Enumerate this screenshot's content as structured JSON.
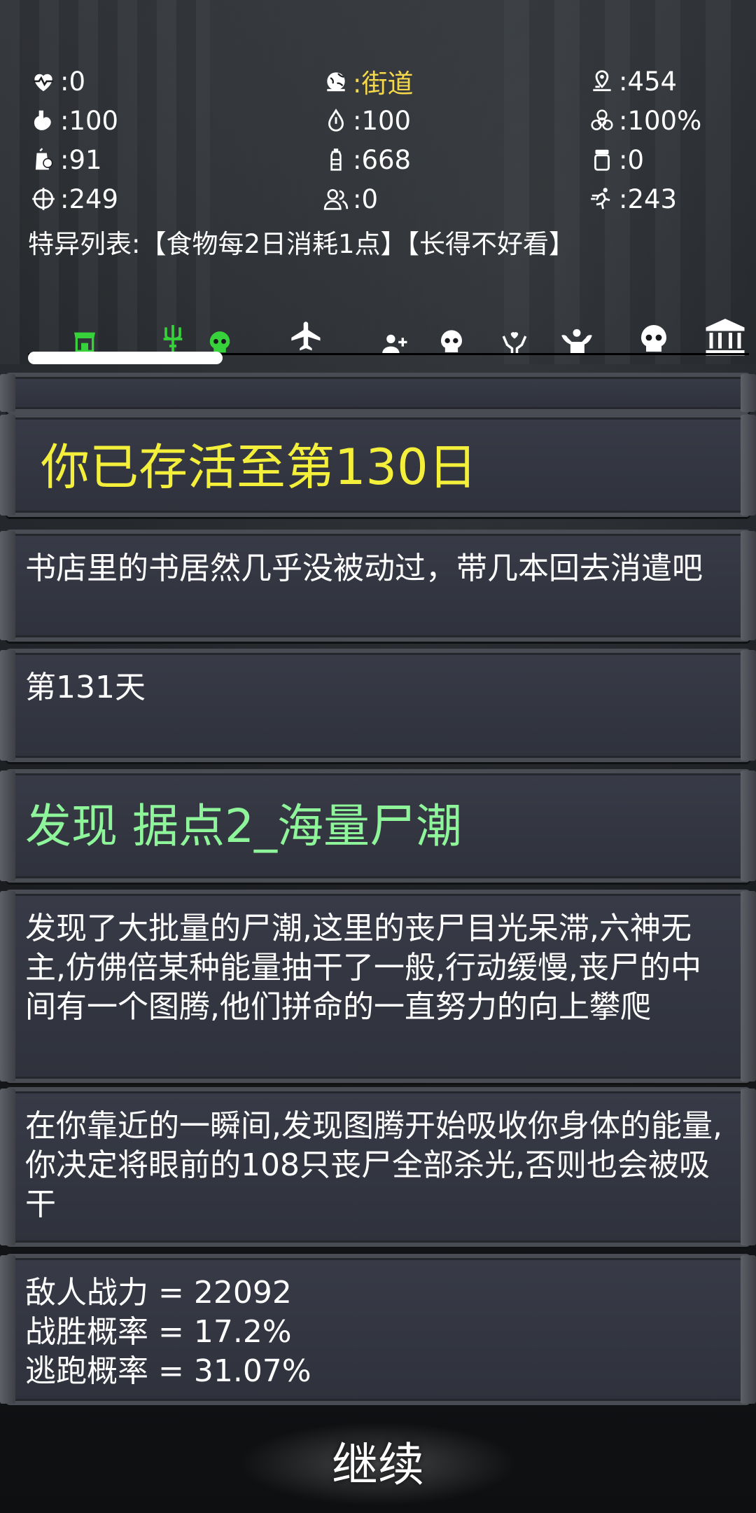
{
  "colors": {
    "location": "#f6d94a",
    "day_heading": "#f4ef3a",
    "event_heading": "#8ff59a",
    "tab_active": "#37d23b"
  },
  "stats": {
    "health": {
      "icon": "heartbeat-icon",
      "value": ":0"
    },
    "location": {
      "icon": "globe-pin-icon",
      "value": ":街道"
    },
    "distance": {
      "icon": "map-pin-icon",
      "value": ":454"
    },
    "hunger": {
      "icon": "stomach-icon",
      "value": ":100"
    },
    "thirst": {
      "icon": "water-drop-icon",
      "value": ":100"
    },
    "infection": {
      "icon": "biohazard-icon",
      "value": ":100%"
    },
    "food": {
      "icon": "food-bag-icon",
      "value": ":91"
    },
    "water": {
      "icon": "water-bottle-icon",
      "value": ":668"
    },
    "medicine": {
      "icon": "pill-jar-icon",
      "value": ":0"
    },
    "attack": {
      "icon": "crosshair-icon",
      "value": ":249"
    },
    "survivors": {
      "icon": "people-icon",
      "value": ":0"
    },
    "agility": {
      "icon": "runner-icon",
      "value": ":243"
    }
  },
  "traits": "特异列表:【食物每2日消耗1点】【长得不好看】",
  "tabs": [
    {
      "name": "tab-shop",
      "icon": "shop-icon",
      "active": true
    },
    {
      "name": "tab-trident",
      "icon": "trident-icon",
      "active": true
    },
    {
      "name": "tab-skull-green",
      "icon": "skull-icon",
      "active": true
    },
    {
      "name": "tab-travel",
      "icon": "airplane-icon",
      "active": false
    },
    {
      "name": "tab-recruit",
      "icon": "add-user-icon",
      "active": false
    },
    {
      "name": "tab-skull",
      "icon": "skull-icon",
      "active": false
    },
    {
      "name": "tab-heal",
      "icon": "heart-hands-icon",
      "active": false
    },
    {
      "name": "tab-strength",
      "icon": "muscle-icon",
      "active": false
    },
    {
      "name": "tab-zombies",
      "icon": "skull-icon",
      "active": false
    },
    {
      "name": "tab-bank",
      "icon": "bank-icon",
      "active": false
    }
  ],
  "log": {
    "day_survived": "你已存活至第130日",
    "bookstore": "书店里的书居然几乎没被动过，带几本回去消遣吧",
    "day_next": "第131天",
    "discovery": "发现 据点2_海量尸潮",
    "horde_desc": "发现了大批量的尸潮,这里的丧尸目光呆滞,六神无主,仿佛倍某种能量抽干了一般,行动缓慢,丧尸的中间有一个图腾,他们拼命的一直努力的向上攀爬",
    "totem_desc": "在你靠近的一瞬间,发现图腾开始吸收你身体的能量,你决定将眼前的108只丧尸全部杀光,否则也会被吸干",
    "enemy_power": "敌人战力 = 22092",
    "win_rate": "战胜概率 = 17.2%",
    "escape_rate": "逃跑概率 = 31.07%"
  },
  "continue_label": "继续"
}
